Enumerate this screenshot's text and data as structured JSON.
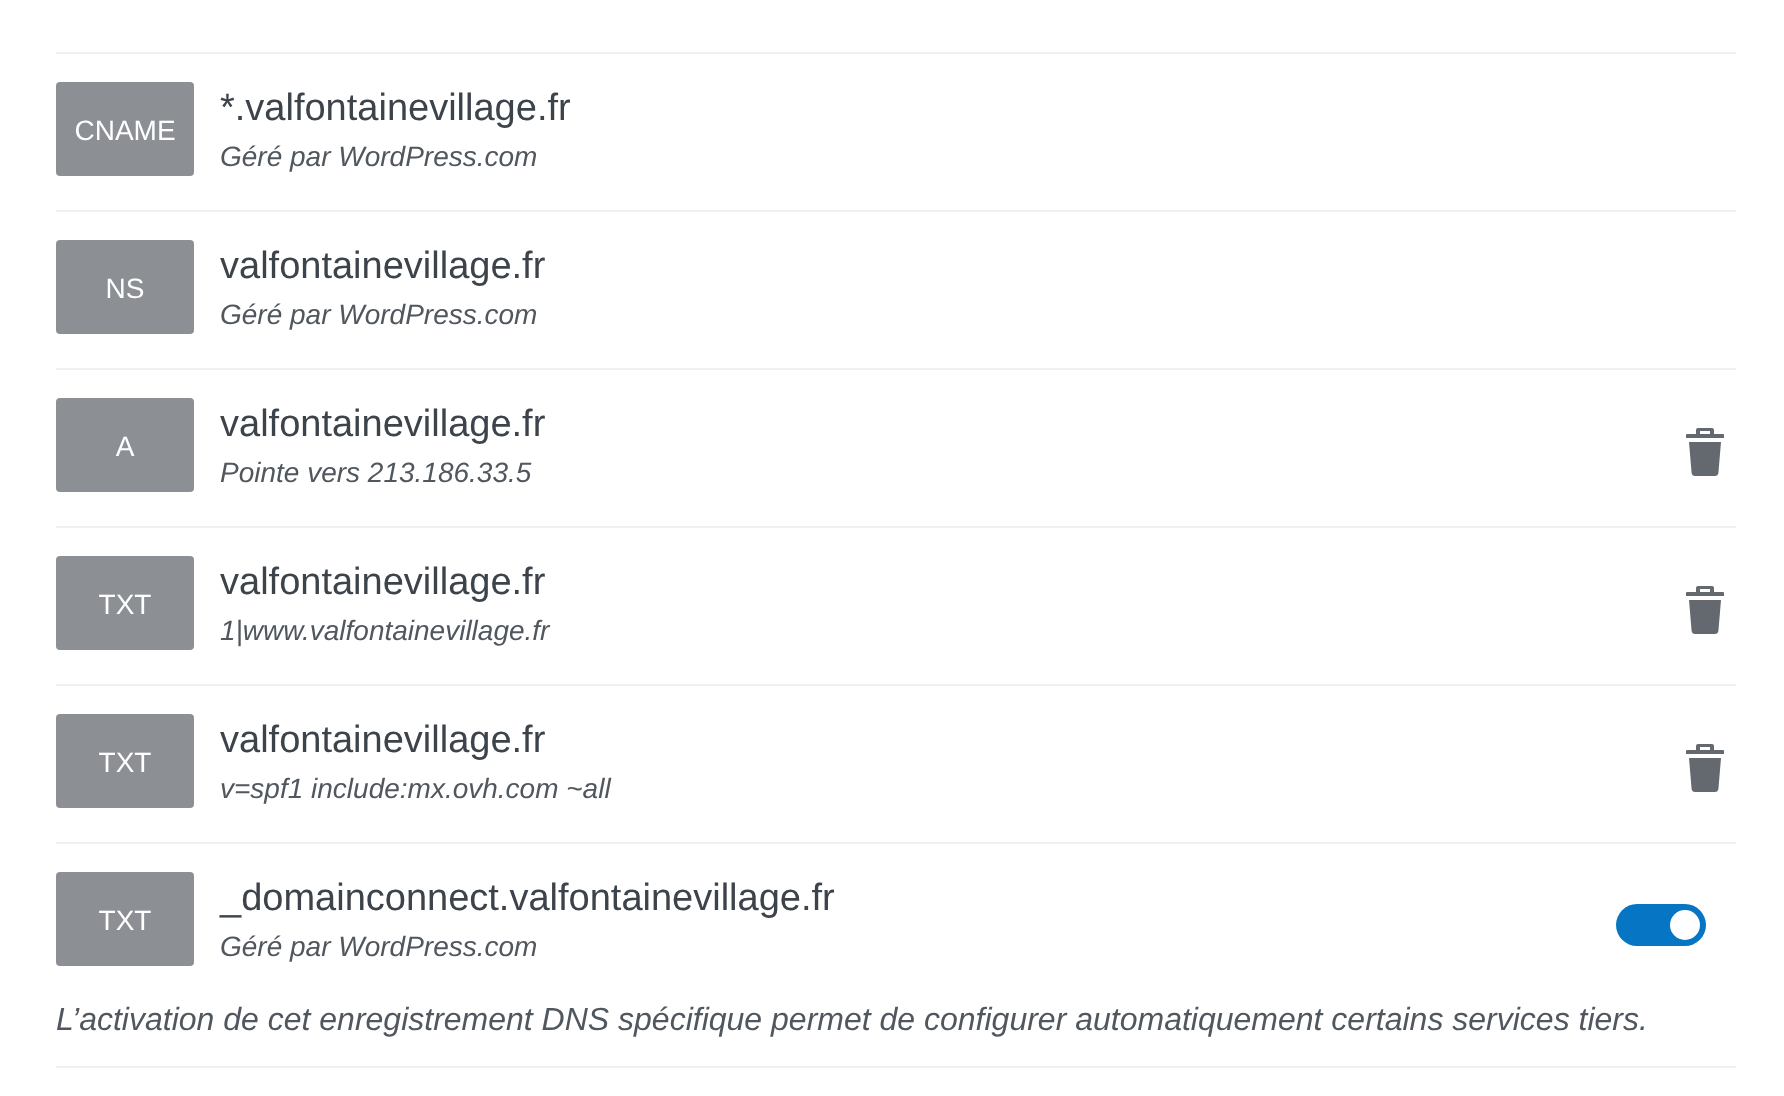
{
  "records": [
    {
      "type": "CNAME",
      "name": "*.valfontainevillage.fr",
      "detail": "Géré par WordPress.com",
      "kind": "plain"
    },
    {
      "type": "NS",
      "name": "valfontainevillage.fr",
      "detail": "Géré par WordPress.com",
      "kind": "plain"
    },
    {
      "type": "A",
      "name": "valfontainevillage.fr",
      "detail": "Pointe vers 213.186.33.5",
      "kind": "delete"
    },
    {
      "type": "TXT",
      "name": "valfontainevillage.fr",
      "detail": "1|www.valfontainevillage.fr",
      "kind": "delete"
    },
    {
      "type": "TXT",
      "name": "valfontainevillage.fr",
      "detail": "v=spf1 include:mx.ovh.com ~all",
      "kind": "delete"
    },
    {
      "type": "TXT",
      "name": "_domainconnect.valfontainevillage.fr",
      "detail": "Géré par WordPress.com",
      "kind": "toggle",
      "on": true
    }
  ],
  "note": "L’activation de cet enregistrement DNS spécifique permet de configurer automatiquement certains services tiers."
}
